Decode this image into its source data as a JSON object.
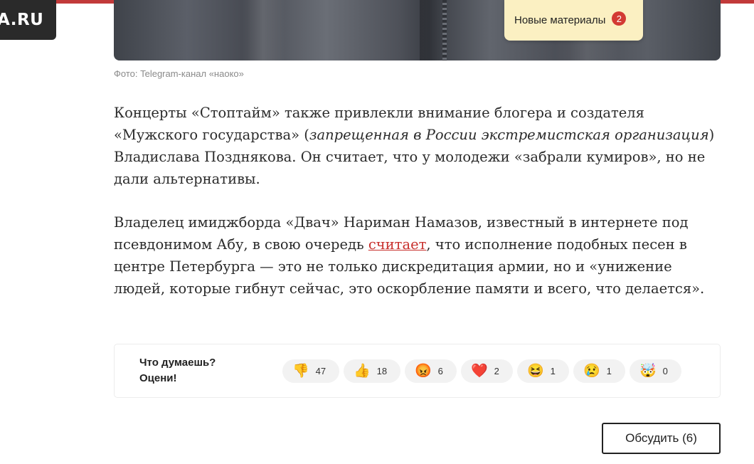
{
  "header": {
    "logo_text": "A.RU"
  },
  "photo": {
    "caption": "Фото: Telegram-канал «наоко»"
  },
  "notifications": {
    "label": "Новые материалы",
    "count": "2"
  },
  "article": {
    "p1_before_italic": "Концерты «Стоптайм» также привлекли внимание блогера и создателя «Мужского государства» (",
    "p1_italic": "запрещенная в России экстремистская организация",
    "p1_after_italic": ") Владислава Позднякова. Он считает, что у молодежи «забрали кумиров», но не дали альтернативы.",
    "p2_before_link": "Владелец имиджборда «Двач» Нариман Намазов, известный в интернете под псевдонимом Абу, в свою очередь ",
    "p2_link": "считает",
    "p2_after_link": ", что исполнение подобных песен в центре Петербурга — это не только дискредитация армии, но и «унижение людей, которые гибнут сейчас, это оскорбление памяти и всего, что делается»."
  },
  "reactions": {
    "title_line1": "Что думаешь?",
    "title_line2": "Оцени!",
    "items": [
      {
        "icon": "thumbs-down-icon",
        "glyph": "👎",
        "count": "47"
      },
      {
        "icon": "thumbs-up-icon",
        "glyph": "👍",
        "count": "18"
      },
      {
        "icon": "angry-face-icon",
        "glyph": "😡",
        "count": "6"
      },
      {
        "icon": "heart-icon",
        "glyph": "❤️",
        "count": "2"
      },
      {
        "icon": "laughing-face-icon",
        "glyph": "😆",
        "count": "1"
      },
      {
        "icon": "sad-face-icon",
        "glyph": "😢",
        "count": "1"
      },
      {
        "icon": "shocked-face-icon",
        "glyph": "🤯",
        "count": "0"
      }
    ]
  },
  "comments": {
    "button_label": "Обсудить (6)"
  },
  "colors": {
    "accent_red": "#c23a3a",
    "badge_bg": "#fbf0c2",
    "badge_count_bg": "#d33a33",
    "link": "#c8302d"
  }
}
